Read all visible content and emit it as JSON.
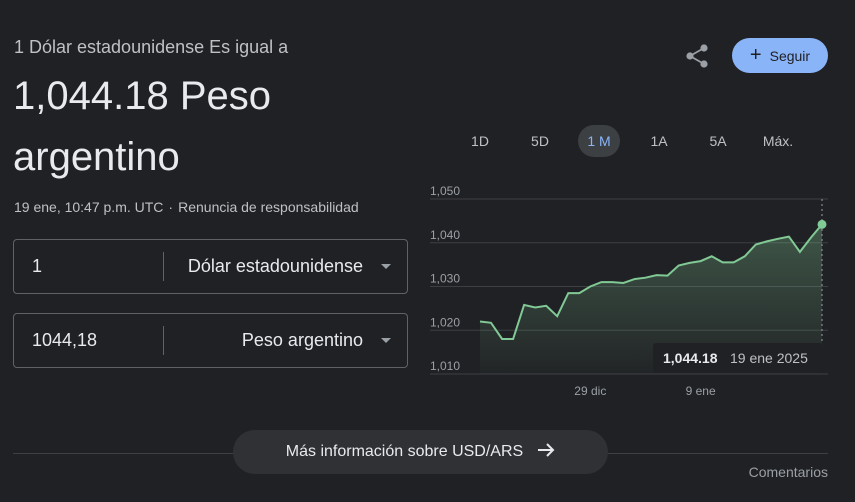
{
  "header": {
    "subtitle": "1 Dólar estadounidense Es igual a",
    "value_line1": "1,044.18 Peso",
    "value_line2": "argentino",
    "timestamp": "19 ene, 10:47 p.m. UTC",
    "separator": "·",
    "disclaimer": "Renuncia de responsabilidad"
  },
  "actions": {
    "share_icon": "share-icon",
    "follow_label": "Seguir",
    "follow_color": "#8ab4f8"
  },
  "tabs": [
    {
      "label": "1D",
      "active": false
    },
    {
      "label": "5D",
      "active": false
    },
    {
      "label": "1 M",
      "active": true
    },
    {
      "label": "1A",
      "active": false
    },
    {
      "label": "5A",
      "active": false
    },
    {
      "label": "Máx.",
      "active": false
    }
  ],
  "converter": {
    "from": {
      "value": "1",
      "currency": "Dólar estadounidense"
    },
    "to": {
      "value": "1044,18",
      "currency": "Peso argentino"
    }
  },
  "chart_data": {
    "type": "area",
    "ylim": [
      1010,
      1050
    ],
    "yticks": [
      1010,
      1020,
      1030,
      1040,
      1050
    ],
    "ytick_labels": [
      "1,010",
      "1,020",
      "1,030",
      "1,040",
      "1,050"
    ],
    "xtick_labels": [
      {
        "label": "29 dic",
        "day": 10
      },
      {
        "label": "9 ene",
        "day": 20
      }
    ],
    "values": [
      1022.0,
      1021.7,
      1018.0,
      1018.0,
      1025.8,
      1025.2,
      1025.6,
      1023.2,
      1028.5,
      1028.5,
      1030.0,
      1031.0,
      1031.0,
      1030.8,
      1031.7,
      1032.0,
      1032.6,
      1032.5,
      1034.8,
      1035.4,
      1035.8,
      1036.9,
      1035.5,
      1035.5,
      1036.9,
      1039.6,
      1040.3,
      1040.9,
      1041.4,
      1037.9,
      1041.2,
      1044.2
    ],
    "line_color": "#81c995",
    "tooltip": {
      "value": "1,044.18",
      "date": "19 ene 2025"
    }
  },
  "footer": {
    "more_info": "Más información sobre USD/ARS",
    "arrow_icon": "arrow-right-icon",
    "comments": "Comentarios"
  }
}
